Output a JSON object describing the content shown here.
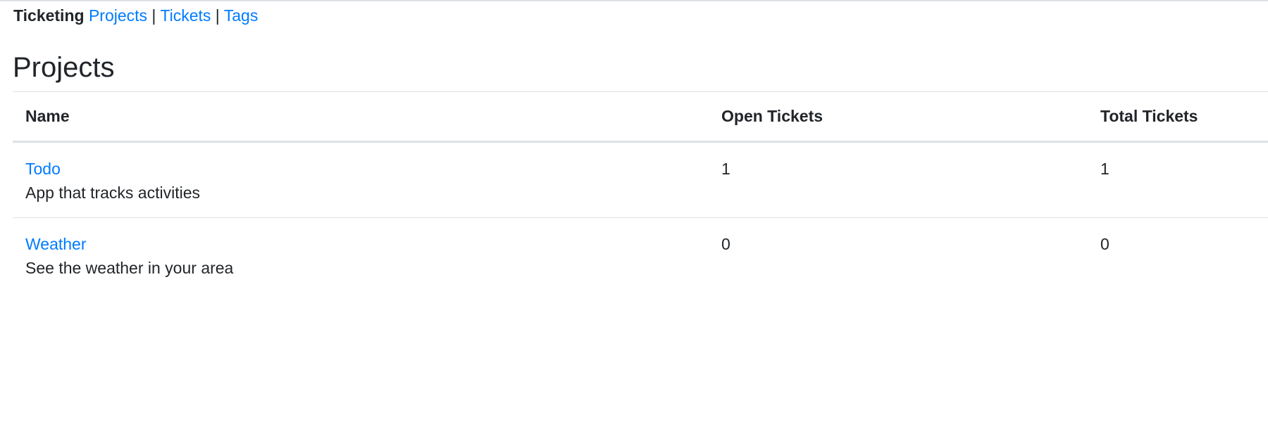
{
  "nav": {
    "brand": "Ticketing",
    "links": [
      "Projects",
      "Tickets",
      "Tags"
    ],
    "separator": "|"
  },
  "page": {
    "title": "Projects"
  },
  "table": {
    "headers": [
      "Name",
      "Open Tickets",
      "Total Tickets"
    ],
    "rows": [
      {
        "name": "Todo",
        "description": "App that tracks activities",
        "open": "1",
        "total": "1"
      },
      {
        "name": "Weather",
        "description": "See the weather in your area",
        "open": "0",
        "total": "0"
      }
    ]
  },
  "colors": {
    "link": "#007bff",
    "text": "#212529",
    "border": "#dee2e6"
  }
}
